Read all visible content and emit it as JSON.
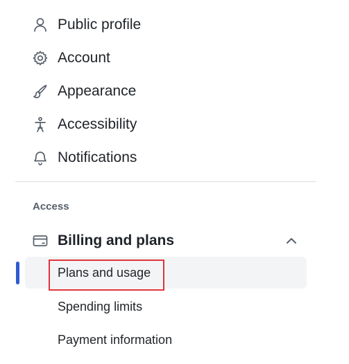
{
  "settings_nav": {
    "items": [
      {
        "label": "Public profile",
        "icon": "person-icon"
      },
      {
        "label": "Account",
        "icon": "gear-icon"
      },
      {
        "label": "Appearance",
        "icon": "paintbrush-icon"
      },
      {
        "label": "Accessibility",
        "icon": "accessibility-icon"
      },
      {
        "label": "Notifications",
        "icon": "bell-icon"
      }
    ],
    "access_heading": "Access",
    "billing": {
      "label": "Billing and plans",
      "icon": "credit-card-icon",
      "expanded": true,
      "subitems": [
        {
          "label": "Plans and usage",
          "active": true
        },
        {
          "label": "Spending limits",
          "active": false
        },
        {
          "label": "Payment information",
          "active": false
        }
      ]
    }
  },
  "colors": {
    "active_indicator": "#2f5bd3",
    "highlight_border": "#e0343a",
    "active_background": "#f3f4f6"
  }
}
